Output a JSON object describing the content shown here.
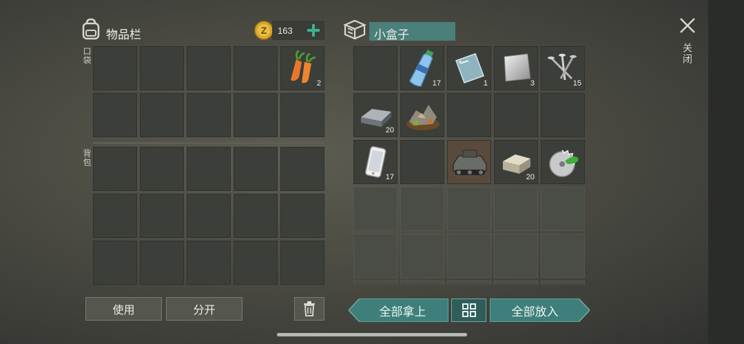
{
  "inventory": {
    "title": "物品栏",
    "coins": "163",
    "pocket_label": "口袋",
    "backpack_label": "背包",
    "carrot_qty": "2"
  },
  "container": {
    "title": "小盒子",
    "items": [
      {
        "icon": "water-bottle-icon",
        "qty": "17"
      },
      {
        "icon": "glass-pane-icon",
        "qty": "1"
      },
      {
        "icon": "metal-sheet-icon",
        "qty": "3"
      },
      {
        "icon": "nails-icon",
        "qty": "15"
      },
      {
        "icon": "metal-ingot-icon",
        "qty": "20"
      },
      {
        "icon": "scrap-pile-icon",
        "qty": ""
      },
      {
        "icon": "smartphone-icon",
        "qty": "17"
      },
      {
        "icon": "armored-vehicle-icon",
        "qty": ""
      },
      {
        "icon": "stone-block-icon",
        "qty": "20"
      },
      {
        "icon": "saw-blade-icon",
        "qty": ""
      }
    ]
  },
  "buttons": {
    "use": "使用",
    "split": "分开",
    "take_all": "全部拿上",
    "put_all": "全部放入",
    "close": "关闭"
  },
  "colors": {
    "accent_teal": "#3f7f7b",
    "coin_gold": "#d9a72a",
    "plus_green": "#3fb08c"
  }
}
